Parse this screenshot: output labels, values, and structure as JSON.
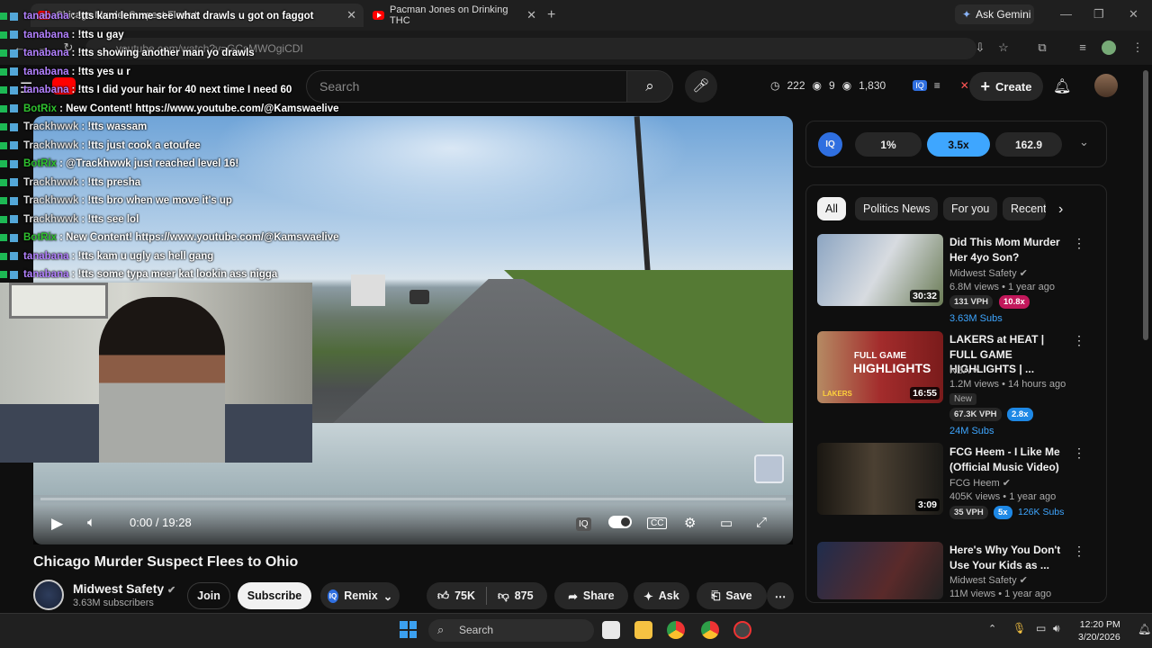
{
  "browser": {
    "tabs": [
      {
        "title": "Chicago Murder Suspect Flees t"
      },
      {
        "title": "Pacman Jones on Drinking THC"
      }
    ],
    "gemini_label": "Ask Gemini",
    "url": "youtube.com/watch?v=GCsMWOgiCDI"
  },
  "youtube": {
    "search_placeholder": "Search",
    "stats": {
      "a": "222",
      "b": "9",
      "c": "1,830"
    },
    "create_label": "Create"
  },
  "video": {
    "time": "0:00 / 19:28",
    "title": "Chicago Murder Suspect Flees to Ohio",
    "progress": 0.0
  },
  "channel": {
    "name": "Midwest Safety",
    "subscribers": "3.63M subscribers",
    "join_label": "Join",
    "subscribe_label": "Subscribe",
    "remix_label": "Remix"
  },
  "actions": {
    "likes": "75K",
    "dislikes": "875",
    "share": "Share",
    "ask": "Ask",
    "save": "Save"
  },
  "iq": {
    "p1": "1%",
    "p2": "3.5x",
    "p3": "162.9"
  },
  "chips": [
    "All",
    "Politics News",
    "For you",
    "Recent"
  ],
  "recs": [
    {
      "title": "Did This Mom Murder Her 4yo Son?",
      "channel": "Midwest Safety",
      "meta": "6.8M views • 1 year ago",
      "duration": "30:32",
      "vph": "131 VPH",
      "mult": "10.8x",
      "subs": "3.63M",
      "subs_suffix": "Subs"
    },
    {
      "title": "LAKERS at HEAT | FULL GAME HIGHLIGHTS | ...",
      "channel": "NBA",
      "meta": "1.2M views • 14 hours ago",
      "duration": "16:55",
      "new_label": "New",
      "vph": "67.3K VPH",
      "mult": "2.8x",
      "subs": "24M",
      "subs_suffix": "Subs",
      "thumb_text1": "FULL GAME",
      "thumb_text2": "HIGHLIGHTS",
      "thumb_text3": "LAKERS"
    },
    {
      "title": "FCG Heem - I Like Me (Official Music Video)",
      "channel": "FCG Heem",
      "meta": "405K views • 1 year ago",
      "duration": "3:09",
      "vph": "35 VPH",
      "mult": "5x",
      "subs": "126K",
      "subs_suffix": "Subs"
    },
    {
      "title": "Here's Why You Don't Use Your Kids as ...",
      "channel": "Midwest Safety",
      "meta": "11M views • 1 year ago"
    }
  ],
  "chat": [
    {
      "user": "tanabana",
      "msg": ": !tts kam lemme see what drawls u got on faggot",
      "c": "tan"
    },
    {
      "user": "tanabana",
      "msg": ": !tts u gay",
      "c": "tan"
    },
    {
      "user": "tanabana",
      "msg": ": !tts showing another man yo drawls",
      "c": "tan"
    },
    {
      "user": "tanabana",
      "msg": ": !tts yes u r",
      "c": "tan"
    },
    {
      "user": "tanabana",
      "msg": ": !tts I did your hair for 40 next time I need 60",
      "c": "tan"
    },
    {
      "user": "BotRix",
      "msg": ": New Content! https://www.youtube.com/@Kamswaelive",
      "c": "bot"
    },
    {
      "user": "Trackhwwk",
      "msg": ": !tts wassam",
      "c": "tr"
    },
    {
      "user": "Trackhwwk",
      "msg": ": !tts just cook a etoufee",
      "c": "tr"
    },
    {
      "user": "BotRix",
      "msg": ": @Trackhwwk just reached level 16!",
      "c": "bot"
    },
    {
      "user": "Trackhwwk",
      "msg": ": !tts presha",
      "c": "tr"
    },
    {
      "user": "Trackhwwk",
      "msg": ": !tts bro when we move it's up",
      "c": "tr"
    },
    {
      "user": "Trackhwwk",
      "msg": ": !tts see lol",
      "c": "tr"
    },
    {
      "user": "BotRix",
      "msg": ": New Content! https://www.youtube.com/@Kamswaelive",
      "c": "bot"
    },
    {
      "user": "tanabana",
      "msg": ": !tts kam u ugly as hell gang",
      "c": "tan"
    },
    {
      "user": "tanabana",
      "msg": ": !tts some typa meer kat lookin ass nigga",
      "c": "tan"
    }
  ],
  "taskbar": {
    "search": "Search",
    "time": "12:20 PM",
    "date": "3/20/2026"
  }
}
